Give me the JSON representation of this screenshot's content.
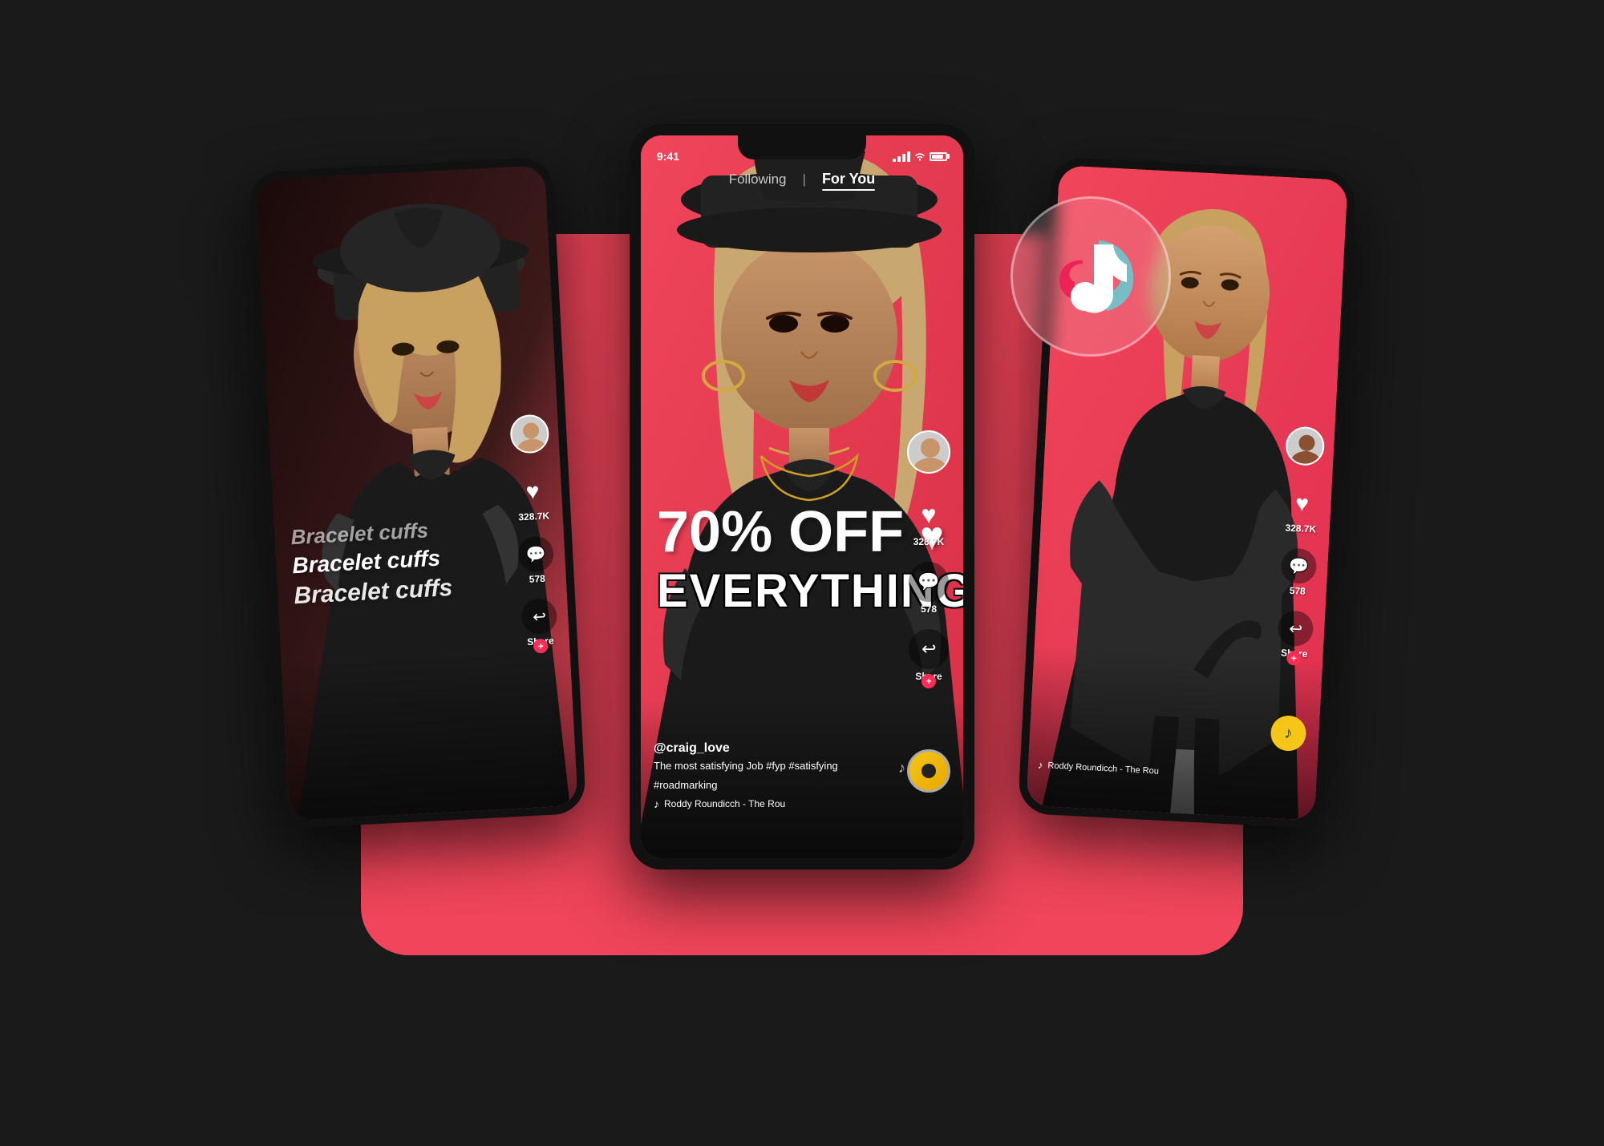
{
  "app": {
    "name": "TikTok",
    "bg_color": "#1a1a1a",
    "accent_color": "#f0455a"
  },
  "center_phone": {
    "status": {
      "time": "9:41",
      "signal": "full",
      "wifi": true,
      "battery": "75%"
    },
    "nav": {
      "following_label": "Following",
      "divider": "|",
      "for_you_label": "For You"
    },
    "content": {
      "sale_main": "70% OFF",
      "sale_sub": "EVERYTHING",
      "username": "@craig_love",
      "caption": "The most satisfying Job #fyp #satisfying",
      "caption2": "#roadmarking",
      "music": "Roddy Roundicch - The Rou"
    },
    "sidebar": {
      "likes": "328.7K",
      "comments": "578",
      "share_label": "Share"
    }
  },
  "left_phone": {
    "content": {
      "text1": "Bracelet cuffs",
      "text2": "Bracelet cuffs",
      "text3": "Bracelet cuffs"
    },
    "sidebar": {
      "likes": "328.7K",
      "comments": "578",
      "share_label": "Share"
    }
  },
  "right_phone": {
    "sidebar": {
      "likes": "328.7K",
      "comments": "578",
      "share_label": "Share"
    }
  },
  "tiktok_logo": {
    "symbol": "♪",
    "note_color_1": "#69C9D0",
    "note_color_2": "#EE1D52"
  },
  "icons": {
    "heart": "♥",
    "comment": "💬",
    "share": "➤",
    "music": "♪",
    "plus": "+"
  }
}
